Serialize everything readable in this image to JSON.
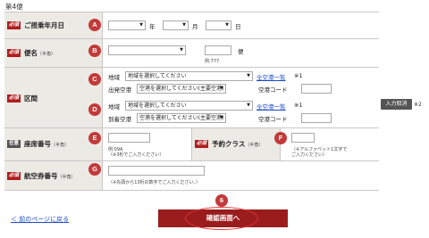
{
  "header": {
    "title": "第4便"
  },
  "required_tag": "必須",
  "optional_tag": "任意",
  "half_width_note": "（半角）",
  "rows": {
    "date": {
      "label": "ご搭乗年月日",
      "badge": "A",
      "year_suffix": "年",
      "month_suffix": "月",
      "day_suffix": "日"
    },
    "flight_name": {
      "label": "便名",
      "badge": "B",
      "suffix": "便",
      "example": "例:777"
    },
    "route": {
      "label": "区間",
      "departure": {
        "badge": "C",
        "region_label": "地域",
        "region_select": "地域を選択してください",
        "all_airports_link": "全空港一覧",
        "note": "※1",
        "airport_label": "出発空港",
        "airport_select": "空港を選択してください(主要空港)",
        "code_label": "空港コード"
      },
      "arrival": {
        "badge": "D",
        "region_label": "地域",
        "region_select": "地域を選択してください",
        "all_airports_link": "全空港一覧",
        "note": "※1",
        "airport_label": "到着空港",
        "airport_select": "空港を選択してください(主要空港)",
        "code_label": "空港コード"
      }
    },
    "seat": {
      "label": "座席番号",
      "badge": "E",
      "example": "例:09A",
      "hint": "（※3桁でご入力ください）"
    },
    "booking_class": {
      "label": "予約クラス",
      "badge": "F",
      "hint_line1": "（※アルファベット1文字で",
      "hint_line2": "ご入力ください）"
    },
    "ticket": {
      "label": "航空券番号",
      "badge": "G",
      "hint": "（※先頭から13桁の数字でご入力ください。）"
    }
  },
  "side": {
    "clear_button": "入力取消",
    "note": "※2"
  },
  "footer": {
    "back_link": "＜ 前のページに戻る",
    "confirm_button": "確認画面へ",
    "confirm_badge": "6"
  }
}
